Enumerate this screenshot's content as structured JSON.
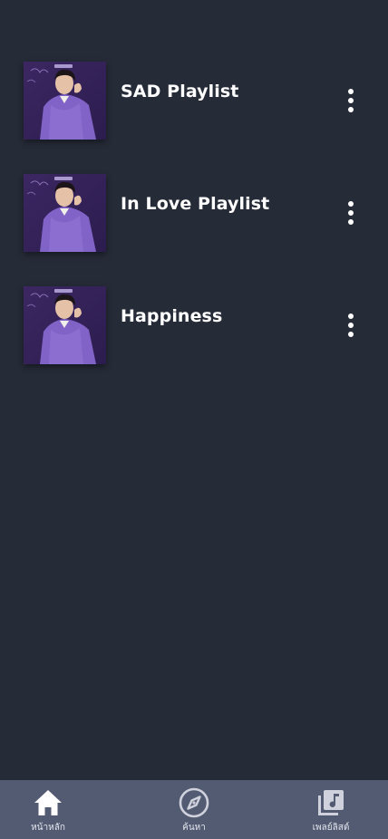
{
  "playlists": [
    {
      "title": "SAD Playlist",
      "cover_icon": "album-cover-icon"
    },
    {
      "title": "In Love Playlist",
      "cover_icon": "album-cover-icon"
    },
    {
      "title": "Happiness",
      "cover_icon": "album-cover-icon"
    }
  ],
  "bottom_nav": {
    "items": [
      {
        "label": "หน้าหลัก",
        "icon": "home-icon"
      },
      {
        "label": "ค้นหา",
        "icon": "compass-icon"
      },
      {
        "label": "เพลย์ลิสต์",
        "icon": "library-music-icon"
      }
    ]
  },
  "colors": {
    "background": "#262b38",
    "nav_background": "#535b72",
    "text": "#ffffff",
    "cover_accent": "#7b5bc4"
  }
}
